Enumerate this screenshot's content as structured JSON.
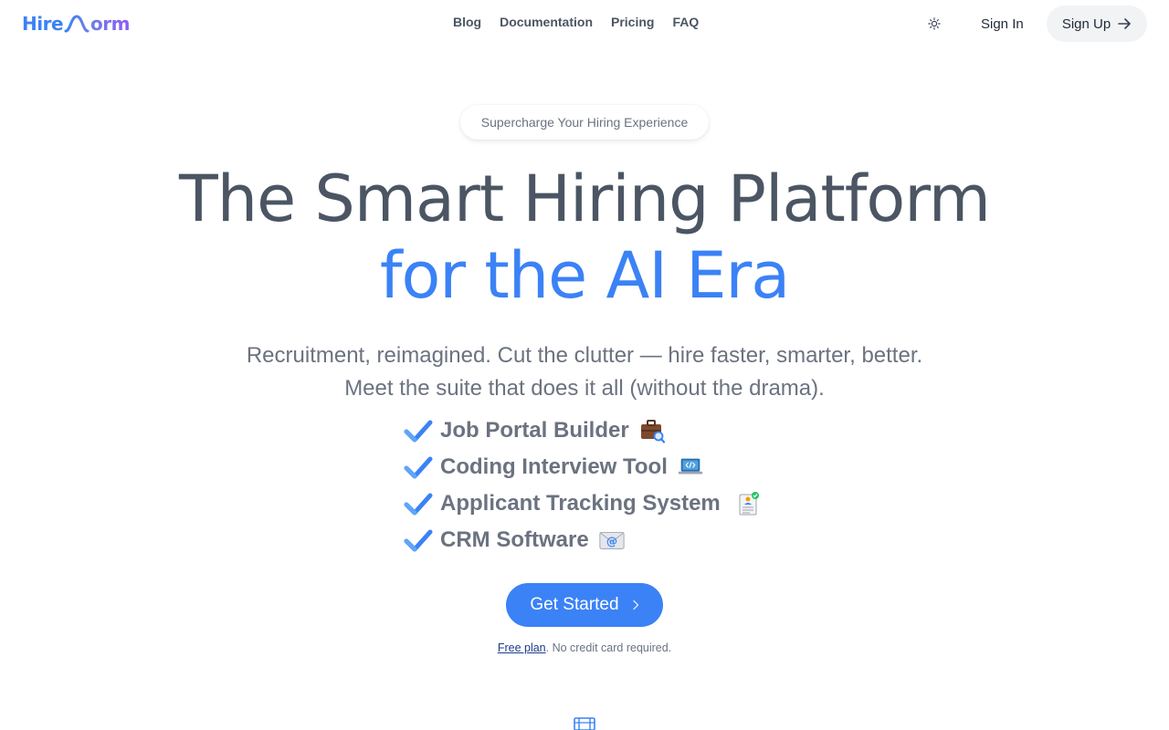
{
  "brand": {
    "logo_head": "Hire",
    "logo_tail": "orm",
    "primary_color": "#3b82f6",
    "accent_color": "#8b5cf6"
  },
  "nav": {
    "items": [
      {
        "label": "Blog"
      },
      {
        "label": "Documentation"
      },
      {
        "label": "Pricing"
      },
      {
        "label": "FAQ"
      }
    ]
  },
  "header": {
    "theme_icon": "sun-icon",
    "signin_label": "Sign In",
    "signup_label": "Sign Up",
    "signup_icon": "arrow-right-icon"
  },
  "hero": {
    "badge": "Supercharge Your Hiring Experience",
    "headline_line1": "The Smart Hiring Platform",
    "headline_line2": "for the AI Era",
    "subtitle_line1": "Recruitment, reimagined. Cut the clutter — hire faster, smarter, better.",
    "subtitle_line2": "Meet the suite that does it all (without the drama).",
    "features": [
      {
        "label": "Job Portal Builder",
        "icon": "briefcase-search-icon"
      },
      {
        "label": "Coding Interview Tool",
        "icon": "laptop-code-icon"
      },
      {
        "label": "Applicant Tracking System",
        "icon": "clipboard-check-icon"
      },
      {
        "label": "CRM Software",
        "icon": "envelope-at-icon"
      }
    ],
    "cta_label": "Get Started",
    "cta_icon": "chevron-right-icon",
    "note_link": "Free plan",
    "note_text": ". No credit card required."
  },
  "section_icon": "film-icon"
}
